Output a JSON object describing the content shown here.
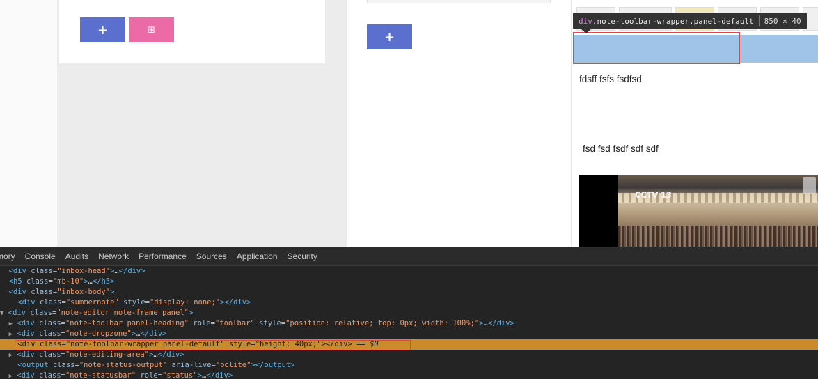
{
  "page": {
    "left_panel": {
      "add_button_label": "+",
      "qr_button_label": "⊞"
    },
    "middle_panel": {
      "add_button_label": "+"
    },
    "tooltip": {
      "tag": "div",
      "classes": ".note-toolbar-wrapper.panel-default",
      "size": "850 × 40"
    },
    "editor": {
      "line1": "fdsff fsfs fsdfsd",
      "line2": "fsd fsd fsdf sdf sdf",
      "video_logo": "CCTV 13"
    }
  },
  "devtools": {
    "tabs": [
      "mory",
      "Console",
      "Audits",
      "Network",
      "Performance",
      "Sources",
      "Application",
      "Security"
    ],
    "lines": [
      {
        "indent": 0,
        "arrow": "",
        "tag": "div",
        "attrs": [
          [
            "class",
            "\"inbox-head\""
          ]
        ],
        "tail": ">…</div>"
      },
      {
        "indent": 0,
        "arrow": "",
        "tag": "h5",
        "attrs": [
          [
            "class",
            "\"mb-10\""
          ]
        ],
        "tail": ">…</h5>"
      },
      {
        "indent": 0,
        "arrow": "",
        "tag": "div",
        "attrs": [
          [
            "class",
            "\"inbox-body\""
          ]
        ],
        "tail": ">"
      },
      {
        "indent": 2,
        "arrow": "",
        "tag": "div",
        "attrs": [
          [
            "class",
            "\"summernote\""
          ],
          [
            "style",
            "\"display: none;\""
          ]
        ],
        "tail": "></div>"
      },
      {
        "indent": 0,
        "arrow": "▼",
        "tag": "div",
        "attrs": [
          [
            "class",
            "\"note-editor note-frame panel\""
          ]
        ],
        "tail": ">"
      },
      {
        "indent": 2,
        "arrow": "▶",
        "tag": "div",
        "attrs": [
          [
            "class",
            "\"note-toolbar panel-heading\""
          ],
          [
            "role",
            "\"toolbar\""
          ],
          [
            "style",
            "\"position: relative; top: 0px; width: 100%;\""
          ]
        ],
        "tail": ">…</div>"
      },
      {
        "indent": 2,
        "arrow": "▶",
        "tag": "div",
        "attrs": [
          [
            "class",
            "\"note-dropzone\""
          ]
        ],
        "tail": ">…</div>"
      },
      {
        "indent": 2,
        "arrow": "",
        "tag": "div",
        "attrs": [
          [
            "class",
            "\"note-toolbar-wrapper panel-default\""
          ],
          [
            "style",
            "\"height: 40px;\""
          ]
        ],
        "tail": "></div>",
        "selected": true,
        "suffix": " == $0"
      },
      {
        "indent": 2,
        "arrow": "▶",
        "tag": "div",
        "attrs": [
          [
            "class",
            "\"note-editing-area\""
          ]
        ],
        "tail": ">…</div>"
      },
      {
        "indent": 2,
        "arrow": "",
        "tag": "output",
        "attrs": [
          [
            "class",
            "\"note-status-output\""
          ],
          [
            "aria-live",
            "\"polite\""
          ]
        ],
        "tail": "></output>"
      },
      {
        "indent": 2,
        "arrow": "▶",
        "tag": "div",
        "attrs": [
          [
            "class",
            "\"note-statusbar\""
          ],
          [
            "role",
            "\"status\""
          ]
        ],
        "tail": ">…</div>"
      }
    ]
  }
}
